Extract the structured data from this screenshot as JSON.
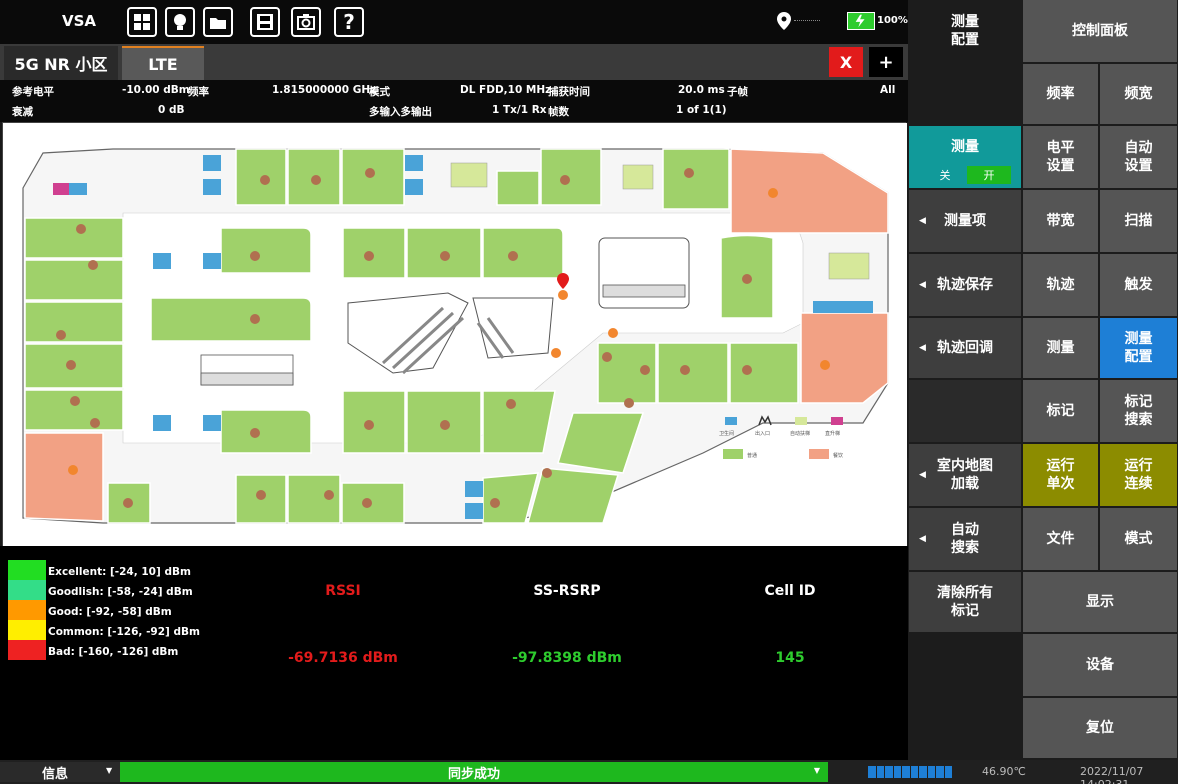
{
  "topbar": {
    "title": "VSA",
    "battery": "100%"
  },
  "tabs": [
    {
      "label": "5G NR 小区"
    },
    {
      "label": "LTE"
    }
  ],
  "tab_close_label": "X",
  "tab_add_label": "+",
  "params": {
    "ref_level_label": "参考电平",
    "ref_level_value": "-10.00 dBm",
    "freq_label": "频率",
    "freq_value": "1.815000000 GHz",
    "mode_label": "模式",
    "mode_value": "DL FDD,10 MHz",
    "capture_label": "捕获时间",
    "capture_value": "20.0 ms",
    "subframe_label": "子帧",
    "subframe_value": "All",
    "atten_label": "衰减",
    "atten_value": "0 dB",
    "mimo_label": "多输入多输出",
    "mimo_value": "1 Tx/1 Rx",
    "frames_label": "帧数",
    "frames_value": "1 of 1(1)"
  },
  "map_legend": {
    "zone_a": "普通",
    "zone_b": "餐饮",
    "icons": [
      "卫生间",
      "出入口",
      "自动扶梯",
      "直升梯"
    ]
  },
  "signal_legend": [
    {
      "label": "Excellent: [-24, 10] dBm",
      "color": "#22dd22"
    },
    {
      "label": "Goodlish: [-58, -24] dBm",
      "color": "#33dd88"
    },
    {
      "label": "Good: [-92, -58] dBm",
      "color": "#ff9900"
    },
    {
      "label": "Common: [-126, -92] dBm",
      "color": "#ffee00"
    },
    {
      "label": "Bad: [-160, -126] dBm",
      "color": "#ee2222"
    }
  ],
  "measurements": {
    "rssi_label": "RSSI",
    "rssi_value": "-69.7136 dBm",
    "rsrp_label": "SS-RSRP",
    "rsrp_value": "-97.8398 dBm",
    "cellid_label": "Cell ID",
    "cellid_value": "145"
  },
  "status": {
    "info_label": "信息",
    "sync_label": "同步成功",
    "temperature": "46.90℃",
    "datetime": "2022/11/07 14:02:31"
  },
  "mid_panel": {
    "header": "测量\n配置",
    "measure_label": "测量",
    "toggle_off": "关",
    "toggle_on": "开",
    "items": [
      "测量项",
      "轨迹保存",
      "轨迹回调",
      "室内地图\n加载",
      "自动\n搜索",
      "清除所有\n标记"
    ]
  },
  "right_panel": {
    "header": "控制面板",
    "buttons": [
      "频率",
      "频宽",
      "电平\n设置",
      "自动\n设置",
      "带宽",
      "扫描",
      "轨迹",
      "触发",
      "测量",
      "测量\n配置",
      "标记",
      "标记\n搜索",
      "运行\n单次",
      "运行\n连续",
      "文件",
      "模式"
    ],
    "wide_buttons": [
      "显示",
      "设备",
      "复位"
    ]
  },
  "colors": {
    "accent_green": "#1eb81e",
    "olive": "#8c8c00",
    "blue_active": "#1e7fd6",
    "teal": "#119a9a",
    "zone_green": "#9fd16a",
    "zone_salmon": "#f2a184",
    "marker_brown": "#b07050",
    "marker_orange": "#f2862e"
  }
}
